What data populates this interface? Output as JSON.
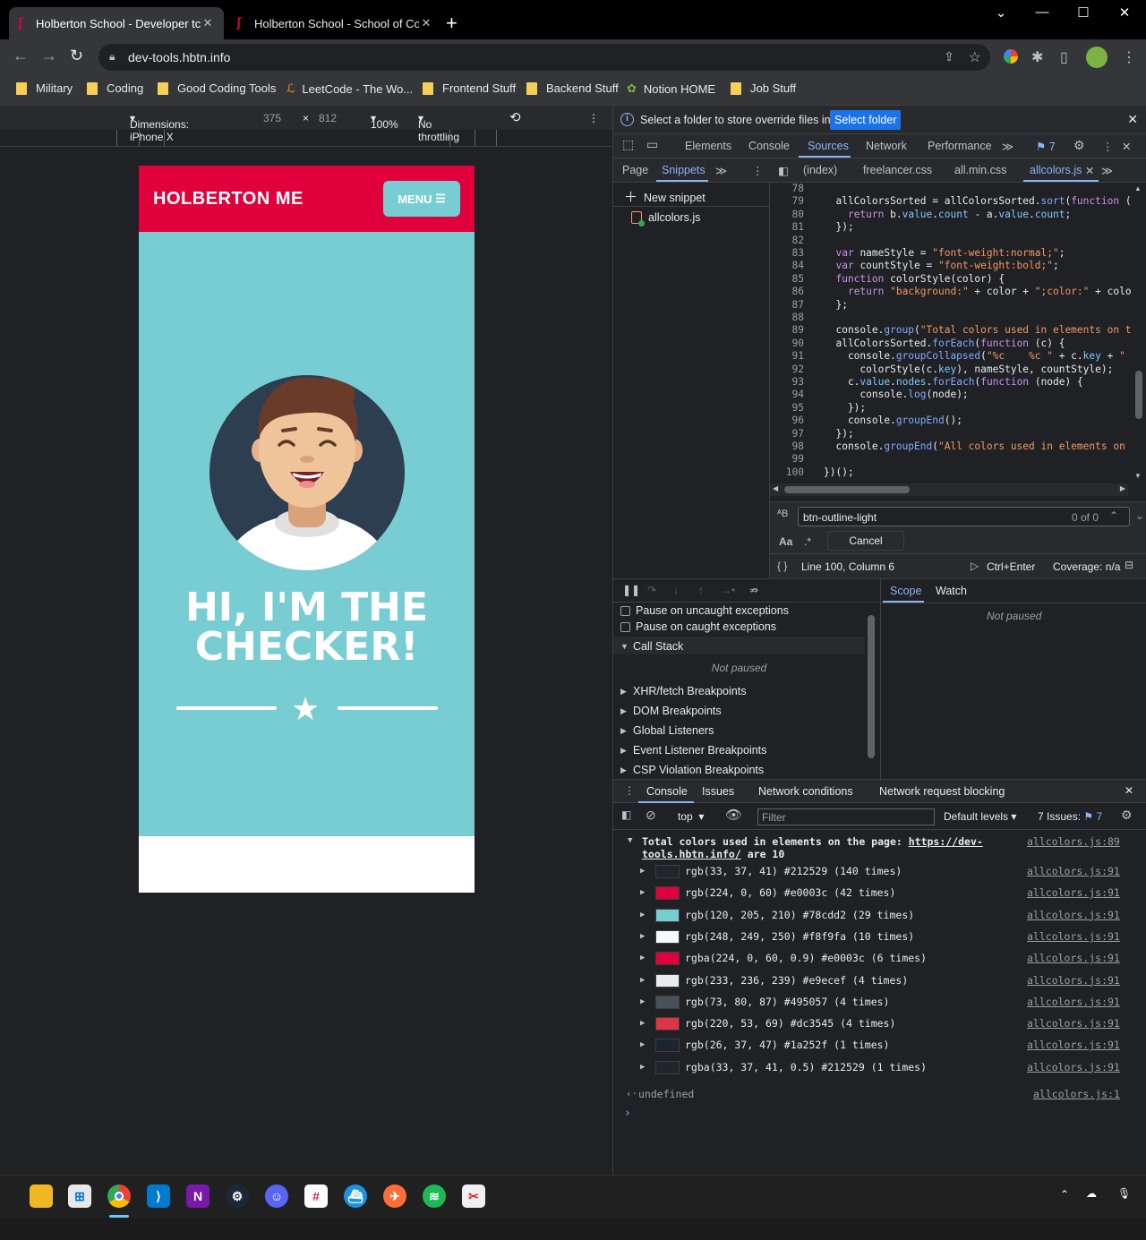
{
  "browser": {
    "tabs": [
      {
        "title": "Holberton School - Developer tc"
      },
      {
        "title": "Holberton School - School of Co"
      }
    ],
    "url": "dev-tools.hbtn.info",
    "bookmarks": [
      "Military",
      "Coding",
      "Good Coding Tools",
      "LeetCode - The Wo...",
      "Frontend Stuff",
      "Backend Stuff",
      "Notion HOME",
      "Job Stuff"
    ]
  },
  "device_toolbar": {
    "dimensions_label": "Dimensions: iPhone X",
    "width": "375",
    "x": "×",
    "height": "812",
    "zoom": "100%",
    "throttling": "No throttling"
  },
  "site": {
    "brand": "HOLBERTON ME",
    "menu_label": "MENU",
    "hero_line1": "HI, I'M THE",
    "hero_line2": "CHECKER!",
    "colors": {
      "primary": "#e0003c",
      "teal": "#78cdd2",
      "dark": "#2c3e50"
    }
  },
  "devtools": {
    "infobar_msg": "Select a folder to store override files in.",
    "select_folder": "Select folder",
    "tabs": [
      "Elements",
      "Console",
      "Sources",
      "Network",
      "Performance"
    ],
    "issues_count": "7",
    "sub_tabs": [
      "Page",
      "Snippets"
    ],
    "file_tabs": [
      "(index)",
      "freelancer.css",
      "all.min.css",
      "allcolors.js"
    ],
    "new_snippet": "New snippet",
    "snippet_file": "allcolors.js",
    "code_lines": [
      {
        "n": "78",
        "t": ""
      },
      {
        "n": "79",
        "t": "  allColorsSorted = allColorsSorted.sort(function (a"
      },
      {
        "n": "80",
        "t": "    return b.value.count - a.value.count;"
      },
      {
        "n": "81",
        "t": "  });"
      },
      {
        "n": "82",
        "t": ""
      },
      {
        "n": "83",
        "t": "  var nameStyle = \"font-weight:normal;\";"
      },
      {
        "n": "84",
        "t": "  var countStyle = \"font-weight:bold;\";"
      },
      {
        "n": "85",
        "t": "  function colorStyle(color) {"
      },
      {
        "n": "86",
        "t": "    return \"background:\" + color + \";color:\" + color"
      },
      {
        "n": "87",
        "t": "  };"
      },
      {
        "n": "88",
        "t": ""
      },
      {
        "n": "89",
        "t": "  console.group(\"Total colors used in elements on th"
      },
      {
        "n": "90",
        "t": "  allColorsSorted.forEach(function (c) {"
      },
      {
        "n": "91",
        "t": "    console.groupCollapsed(\"%c    %c \" + c.key + \" \""
      },
      {
        "n": "92",
        "t": "      colorStyle(c.key), nameStyle, countStyle);"
      },
      {
        "n": "93",
        "t": "    c.value.nodes.forEach(function (node) {"
      },
      {
        "n": "94",
        "t": "      console.log(node);"
      },
      {
        "n": "95",
        "t": "    });"
      },
      {
        "n": "96",
        "t": "    console.groupEnd();"
      },
      {
        "n": "97",
        "t": "  });"
      },
      {
        "n": "98",
        "t": "  console.groupEnd(\"All colors used in elements on t"
      },
      {
        "n": "99",
        "t": ""
      },
      {
        "n": "100",
        "t": "})();"
      }
    ],
    "search_value": "btn-outline-light",
    "search_count": "0 of 0",
    "match_case": "Aa",
    "regex": ".*",
    "cancel": "Cancel",
    "status_position": "Line 100, Column 6",
    "run_shortcut": "Ctrl+Enter",
    "coverage": "Coverage: n/a",
    "debugger": {
      "pause_uncaught": "Pause on uncaught exceptions",
      "pause_caught": "Pause on caught exceptions",
      "call_stack": "Call Stack",
      "not_paused": "Not paused",
      "sections": [
        "XHR/fetch Breakpoints",
        "DOM Breakpoints",
        "Global Listeners",
        "Event Listener Breakpoints",
        "CSP Violation Breakpoints"
      ],
      "scope": "Scope",
      "watch": "Watch",
      "scope_not_paused": "Not paused"
    },
    "drawer_tabs": [
      "Console",
      "Issues",
      "Network conditions",
      "Network request blocking"
    ],
    "console_context": "top",
    "filter_placeholder": "Filter",
    "default_levels": "Default levels",
    "issues_label": "7 Issues:",
    "issues_num": "7",
    "group_header_pre": "Total colors used in elements on the page:",
    "group_header_url": "https://dev-tools.hbtn.info/",
    "group_header_post": "are 10",
    "group_src": "allcolors.js:89",
    "colors": [
      {
        "swatch": "#212529",
        "text": "rgb(33, 37, 41) #212529 (140 times)"
      },
      {
        "swatch": "#e0003c",
        "text": "rgb(224, 0, 60) #e0003c (42 times)"
      },
      {
        "swatch": "#78cdd2",
        "text": "rgb(120, 205, 210) #78cdd2 (29 times)"
      },
      {
        "swatch": "#f8f9fa",
        "text": "rgb(248, 249, 250) #f8f9fa (10 times)"
      },
      {
        "swatch": "#e0003c",
        "text": "rgba(224, 0, 60, 0.9) #e0003c (6 times)"
      },
      {
        "swatch": "#e9ecef",
        "text": "rgb(233, 236, 239) #e9ecef (4 times)"
      },
      {
        "swatch": "#495057",
        "text": "rgb(73, 80, 87) #495057 (4 times)"
      },
      {
        "swatch": "#dc3545",
        "text": "rgb(220, 53, 69) #dc3545 (4 times)"
      },
      {
        "swatch": "#1a252f",
        "text": "rgb(26, 37, 47) #1a252f (1 times)"
      },
      {
        "swatch": "#212529",
        "text": "rgba(33, 37, 41, 0.5) #212529 (1 times)"
      }
    ],
    "color_src": "allcolors.js:91",
    "undefined_text": "undefined",
    "undefined_src": "allcolors.js:1"
  }
}
